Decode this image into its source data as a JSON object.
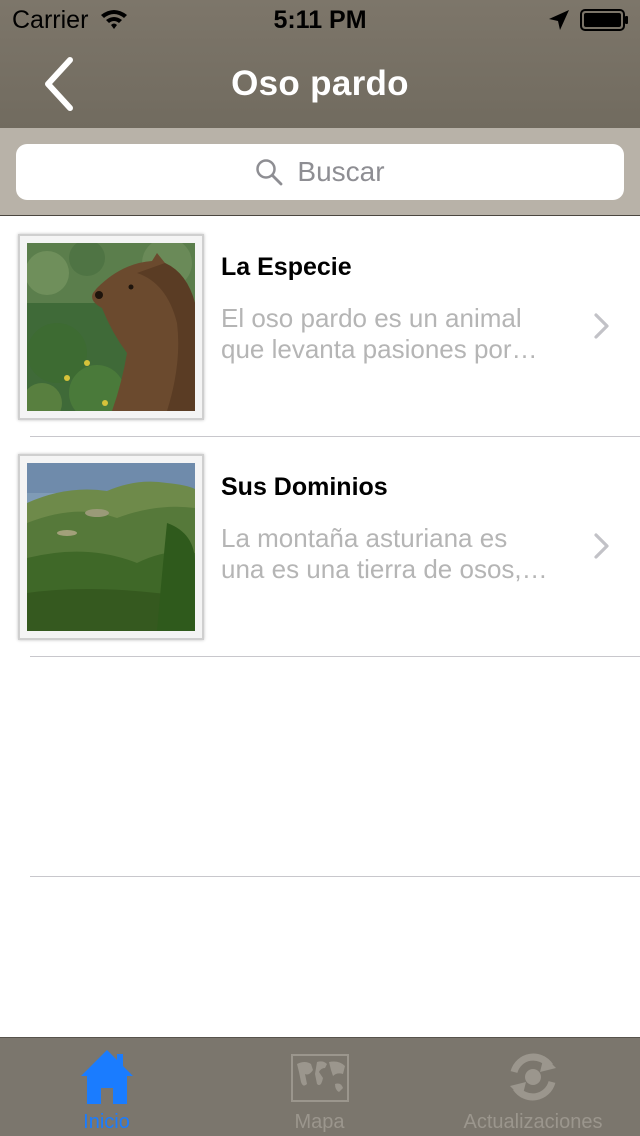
{
  "status_bar": {
    "carrier": "Carrier",
    "time": "5:11 PM"
  },
  "nav": {
    "title": "Oso pardo"
  },
  "search": {
    "placeholder": "Buscar"
  },
  "list": {
    "items": [
      {
        "title": "La Especie",
        "subtitle": "El oso pardo es un animal\nque levanta pasiones por…",
        "image": "brown-bear-photo"
      },
      {
        "title": "Sus Dominios",
        "subtitle": "La montaña asturiana es\nuna es una tierra de osos,…",
        "image": "mountain-landscape-photo"
      }
    ]
  },
  "tab_bar": {
    "tabs": [
      {
        "label": "Inicio",
        "icon": "home-icon",
        "active": true
      },
      {
        "label": "Mapa",
        "icon": "world-map-icon",
        "active": false
      },
      {
        "label": "Actualizaciones",
        "icon": "sync-icon",
        "active": false
      }
    ]
  },
  "colors": {
    "nav_background": "#746e62",
    "search_background": "#b8b2a8",
    "tab_bar_background": "#7b766d",
    "active_tab": "#1a7cff",
    "subtitle_text": "#b5b5b5"
  }
}
